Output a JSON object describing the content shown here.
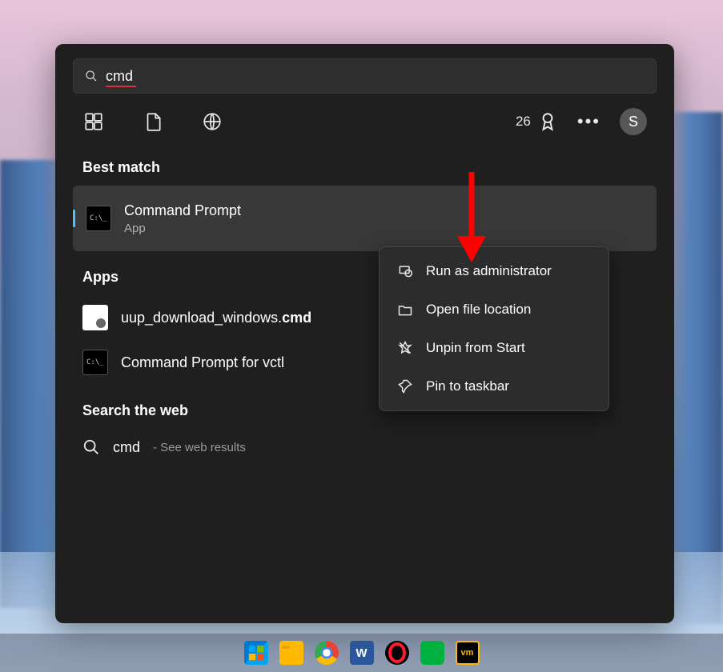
{
  "search": {
    "query": "cmd"
  },
  "rewards": {
    "points": "26"
  },
  "avatar": {
    "initial": "S"
  },
  "sections": {
    "best_match": "Best match",
    "apps": "Apps",
    "web": "Search the web"
  },
  "best_match": {
    "title": "Command Prompt",
    "subtitle": "App"
  },
  "app_results": [
    {
      "prefix": "uup_download_windows.",
      "bold": "cmd"
    },
    {
      "prefix": "Command Prompt for vctl",
      "bold": ""
    }
  ],
  "web_result": {
    "query": "cmd",
    "hint": "- See web results"
  },
  "context_menu": {
    "items": [
      "Run as administrator",
      "Open file location",
      "Unpin from Start",
      "Pin to taskbar"
    ]
  },
  "taskbar": {
    "word_label": "W"
  }
}
